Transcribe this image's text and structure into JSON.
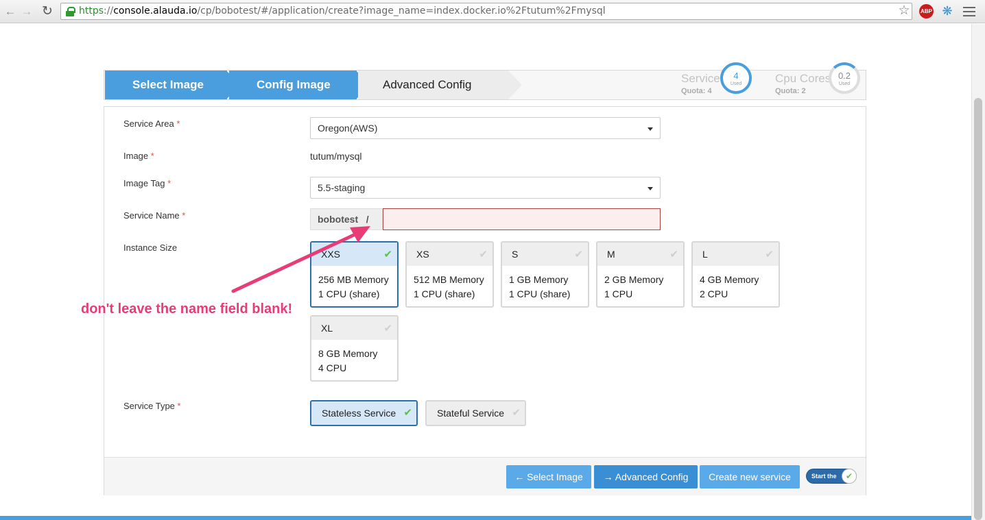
{
  "browser": {
    "url_scheme": "https",
    "url_host": "console.alauda.io",
    "url_path": "/cp/bobotest/#/application/create?image_name=index.docker.io%2Ftutum%2Fmysql",
    "url_sep": "://",
    "abp_badge": "ABP"
  },
  "wizard": {
    "steps": [
      {
        "label": "Select Image",
        "state": "done"
      },
      {
        "label": "Config Image",
        "state": "active"
      },
      {
        "label": "Advanced Config",
        "state": "pending"
      }
    ],
    "service_quota": {
      "label": "Service",
      "quota": "Quota: 4",
      "used": "4",
      "used_label": "Used"
    },
    "cpu_quota": {
      "label": "Cpu Cores",
      "quota": "Quota: 2",
      "used": "0.2",
      "used_label": "Used"
    }
  },
  "form": {
    "service_area": {
      "label": "Service Area",
      "value": "Oregon(AWS)"
    },
    "image": {
      "label": "Image",
      "value": "tutum/mysql"
    },
    "image_tag": {
      "label": "Image Tag",
      "value": "5.5-staging"
    },
    "service_name": {
      "label": "Service Name",
      "prefix": "bobotest",
      "separator": "/",
      "value": ""
    },
    "instance_size": {
      "label": "Instance Size",
      "options": [
        {
          "name": "XXS",
          "memory": "256 MB Memory",
          "cpu": "1 CPU (share)",
          "selected": true
        },
        {
          "name": "XS",
          "memory": "512 MB Memory",
          "cpu": "1 CPU (share)",
          "selected": false
        },
        {
          "name": "S",
          "memory": "1 GB Memory",
          "cpu": "1 CPU (share)",
          "selected": false
        },
        {
          "name": "M",
          "memory": "2 GB Memory",
          "cpu": "1 CPU",
          "selected": false
        },
        {
          "name": "L",
          "memory": "4 GB Memory",
          "cpu": "2 CPU",
          "selected": false
        },
        {
          "name": "XL",
          "memory": "8 GB Memory",
          "cpu": "4 CPU",
          "selected": false
        }
      ]
    },
    "service_type": {
      "label": "Service Type",
      "options": [
        {
          "name": "Stateless Service",
          "selected": true
        },
        {
          "name": "Stateful Service",
          "selected": false
        }
      ]
    },
    "required_mark": "*"
  },
  "footer": {
    "back_button": "← Select Image",
    "next_button": "→ Advanced Config",
    "create_button": "Create new service",
    "toggle_label": "Start the"
  },
  "annotation": {
    "text": "don't leave the name field blank!",
    "color": "#e83c77"
  },
  "colors": {
    "accent": "#4a9ede",
    "selected_border": "#2f6fa7",
    "error_border": "#a94442",
    "check_green": "#5cc04a"
  }
}
